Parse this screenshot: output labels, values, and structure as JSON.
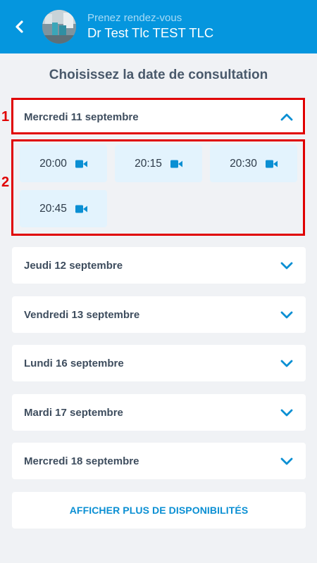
{
  "header": {
    "subtitle": "Prenez rendez-vous",
    "doctor_name": "Dr Test Tlc TEST TLC",
    "back_icon": "chevron-left-icon",
    "background_color": "#0596de"
  },
  "page_title": "Choisissez la date de consultation",
  "days": [
    {
      "label": "Mercredi 11 septembre",
      "expanded": true
    },
    {
      "label": "Jeudi 12 septembre",
      "expanded": false
    },
    {
      "label": "Vendredi 13 septembre",
      "expanded": false
    },
    {
      "label": "Lundi 16 septembre",
      "expanded": false
    },
    {
      "label": "Mardi 17 septembre",
      "expanded": false
    },
    {
      "label": "Mercredi 18 septembre",
      "expanded": false
    }
  ],
  "slots": [
    {
      "time": "20:00",
      "icon": "video-camera-icon"
    },
    {
      "time": "20:15",
      "icon": "video-camera-icon"
    },
    {
      "time": "20:30",
      "icon": "video-camera-icon"
    },
    {
      "time": "20:45",
      "icon": "video-camera-icon"
    }
  ],
  "annotations": [
    "1",
    "2"
  ],
  "more_button": "AFFICHER PLUS DE DISPONIBILITÉS",
  "colors": {
    "accent": "#0596de",
    "slot_bg": "#e3f3fd",
    "annotation": "#e00000"
  }
}
